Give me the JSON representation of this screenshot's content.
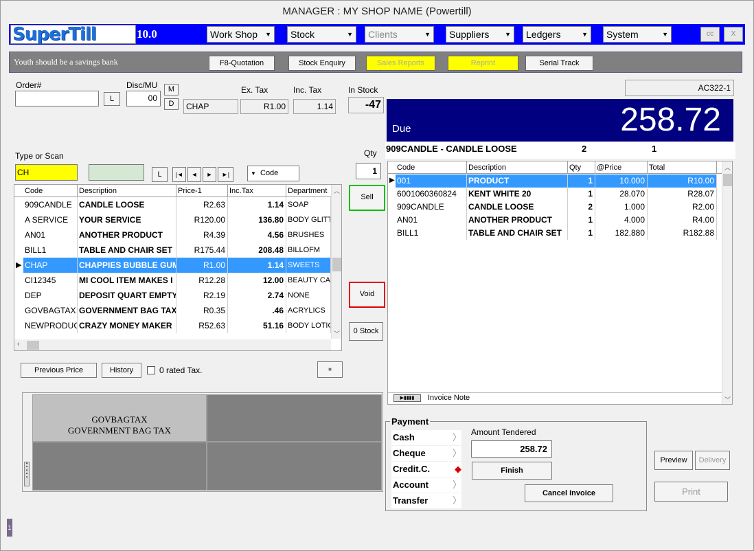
{
  "window": {
    "title": "MANAGER : MY SHOP NAME (Powertill)"
  },
  "brand": {
    "logo": "SuperTill",
    "version": "10.0"
  },
  "menu": [
    {
      "label": "Work Shop",
      "disabled": false
    },
    {
      "label": "Stock",
      "disabled": false
    },
    {
      "label": "Clients",
      "disabled": true
    },
    {
      "label": "Suppliers",
      "disabled": false
    },
    {
      "label": "Ledgers",
      "disabled": false
    },
    {
      "label": "System",
      "disabled": false
    }
  ],
  "window_buttons": {
    "cc": "cc",
    "close": "X"
  },
  "toolbar": {
    "motto": "Youth should be a savings bank",
    "buttons": [
      "F8-Quotation",
      "Stock Enquiry",
      "Sales Reports",
      "Reprint",
      "Serial Track"
    ]
  },
  "order": {
    "order_label": "Order#",
    "order_value": "",
    "l_button": "L",
    "disc_label": "Disc/MU",
    "disc_value": "00",
    "m_button": "M",
    "d_button": "D",
    "extax_label": "Ex. Tax",
    "inctax_label": "Inc. Tax",
    "instock_label": "In Stock",
    "code": "CHAP",
    "extax": "R1.00",
    "inctax": "1.14",
    "instock": "-47"
  },
  "account_code": "AC322-1",
  "due": {
    "label": "Due",
    "amount": "258.72"
  },
  "current_item": {
    "text": "909CANDLE - CANDLE LOOSE",
    "qty": "2",
    "count": "1"
  },
  "scan": {
    "label": "Type or Scan",
    "value": "CH",
    "l_button": "L",
    "qty_label": "Qty",
    "qty_value": "1",
    "sort_label": "Code",
    "nav": [
      "|◄",
      "◄",
      "►",
      "►|"
    ]
  },
  "stock_table": {
    "headers": [
      "Code",
      "Description",
      "Price-1",
      "Inc.Tax",
      "Department"
    ],
    "rows": [
      [
        "909CANDLE",
        "CANDLE LOOSE",
        "R2.63",
        "1.14",
        "SOAP"
      ],
      [
        "A SERVICE",
        "YOUR SERVICE",
        "R120.00",
        "136.80",
        "BODY GLITTE"
      ],
      [
        "AN01",
        "ANOTHER PRODUCT",
        "R4.39",
        "4.56",
        "BRUSHES"
      ],
      [
        "BILL1",
        "TABLE AND CHAIR SET",
        "R175.44",
        "208.48",
        "BILLOFM"
      ],
      [
        "CHAP",
        "CHAPPIES BUBBLE GUM",
        "R1.00",
        "1.14",
        "SWEETS"
      ],
      [
        "CI12345",
        "MI COOL ITEM MAKES I",
        "R12.28",
        "12.00",
        "BEAUTY CASI"
      ],
      [
        "DEP",
        "DEPOSIT QUART EMPTY",
        "R2.19",
        "2.74",
        "NONE"
      ],
      [
        "GOVBAGTAX",
        "GOVERNMENT BAG TAX",
        "R0.35",
        ".46",
        "ACRYLICS"
      ],
      [
        "NEWPRODUCT",
        "CRAZY MONEY MAKER",
        "R52.63",
        "51.16",
        "BODY LOTION"
      ]
    ],
    "selected_index": 4
  },
  "side_buttons": {
    "sell": "Sell",
    "void": "Void",
    "zero_stock": "0 Stock"
  },
  "invoice_table": {
    "headers": [
      "Code",
      "Description",
      "Qty",
      "@Price",
      "Total"
    ],
    "rows": [
      [
        "001",
        "PRODUCT",
        "1",
        "10.000",
        "R10.00"
      ],
      [
        "6001060360824",
        "KENT WHITE 20",
        "1",
        "28.070",
        "R28.07"
      ],
      [
        "909CANDLE",
        "CANDLE LOOSE",
        "2",
        "1.000",
        "R2.00"
      ],
      [
        "AN01",
        "ANOTHER PRODUCT",
        "1",
        "4.000",
        "R4.00"
      ],
      [
        "BILL1",
        "TABLE AND CHAIR SET",
        "1",
        "182.880",
        "R182.88"
      ]
    ],
    "selected_index": 0,
    "note_label": "Invoice Note"
  },
  "lower_left": {
    "previous_price": "Previous Price",
    "history": "History",
    "zero_rated": "0 rated Tax.",
    "small_button": "■"
  },
  "grid_tile": {
    "code": "GOVBAGTAX",
    "name": "GOVERNMENT BAG TAX"
  },
  "payment": {
    "legend": "Payment",
    "methods": [
      "Cash",
      "Cheque",
      "Credit.C.",
      "Account",
      "Transfer"
    ],
    "amount_label": "Amount Tendered",
    "amount_value": "258.72",
    "finish": "Finish",
    "cancel": "Cancel Invoice"
  },
  "right_buttons": {
    "preview": "Preview",
    "delivery": "Delivery",
    "print": "Print"
  },
  "status_marker": "1",
  "colors": {
    "menu_bar": "#0000ff",
    "due_bg": "#000080",
    "selection": "#3399ff",
    "scan_field": "#ffff00",
    "sell_border": "#00c000",
    "void_border": "#e00000"
  }
}
